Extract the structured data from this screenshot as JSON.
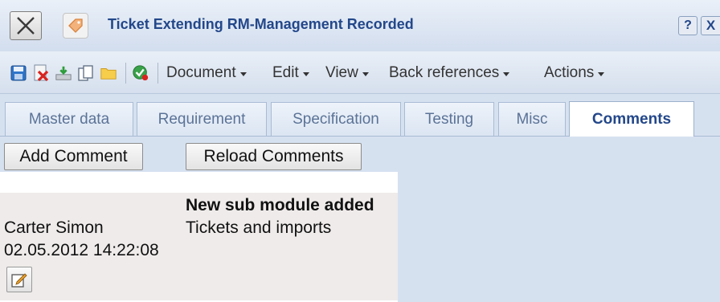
{
  "window": {
    "title": "Ticket Extending RM-Management Recorded",
    "help_label": "?",
    "close_label": "X",
    "close_icon": "close-icon",
    "entity_icon": "tag-icon"
  },
  "toolbar": {
    "icons": [
      "save-icon",
      "delete-icon",
      "download-icon",
      "copy-icon",
      "folder-icon",
      "check-icon"
    ],
    "menus": [
      {
        "label": "Document"
      },
      {
        "label": "Edit"
      },
      {
        "label": "View"
      },
      {
        "label": "Back references"
      },
      {
        "label": "Actions"
      }
    ]
  },
  "tabs": [
    {
      "label": "Master data",
      "active": false
    },
    {
      "label": "Requirement",
      "active": false
    },
    {
      "label": "Specification",
      "active": false
    },
    {
      "label": "Testing",
      "active": false
    },
    {
      "label": "Misc",
      "active": false
    },
    {
      "label": "Comments",
      "active": true
    }
  ],
  "comments_panel": {
    "add_label": "Add Comment",
    "reload_label": "Reload Comments",
    "comment": {
      "author": "Carter Simon",
      "date": "02.05.2012 14:22:08",
      "title": "New sub module added",
      "body": "Tickets and imports",
      "edit_icon": "edit-icon"
    }
  },
  "colors": {
    "accent": "#23478a",
    "background": "#d6e1f0",
    "comment_bg": "#eeebea"
  }
}
